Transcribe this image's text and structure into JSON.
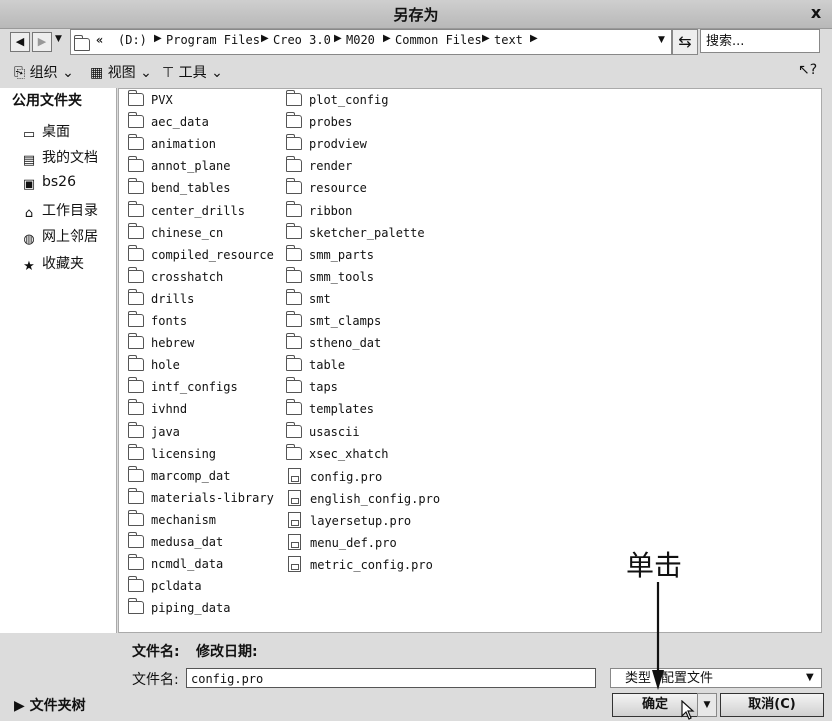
{
  "window": {
    "title": "另存为",
    "close": "x"
  },
  "address": {
    "crumbs": [
      "«",
      "(D:)",
      "Program Files",
      "Creo 3.0",
      "M020",
      "Common Files",
      "text"
    ],
    "search_placeholder": "搜索..."
  },
  "toolbar": {
    "organize": "组织 ⌄",
    "view": "视图 ⌄",
    "tools": "工具 ⌄"
  },
  "sidebar": {
    "header": "公用文件夹",
    "items": [
      "桌面",
      "我的文档",
      "bs26",
      "工作目录",
      "网上邻居",
      "收藏夹"
    ],
    "folder_tree": "文件夹树"
  },
  "files": {
    "col1": [
      "PVX",
      "aec_data",
      "animation",
      "annot_plane",
      "bend_tables",
      "center_drills",
      "chinese_cn",
      "compiled_resource",
      "crosshatch",
      "drills",
      "fonts",
      "hebrew",
      "hole",
      "intf_configs",
      "ivhnd",
      "java",
      "licensing",
      "marcomp_dat",
      "materials-library",
      "mechanism",
      "medusa_dat",
      "ncmdl_data",
      "pcldata",
      "piping_data"
    ],
    "col2_folders": [
      "plot_config",
      "probes",
      "prodview",
      "render",
      "resource",
      "ribbon",
      "sketcher_palette",
      "smm_parts",
      "smm_tools",
      "smt",
      "smt_clamps",
      "stheno_dat",
      "table",
      "taps",
      "templates",
      "usascii",
      "xsec_xhatch"
    ],
    "col2_files": [
      "config.pro",
      "english_config.pro",
      "layersetup.pro",
      "menu_def.pro",
      "metric_config.pro"
    ]
  },
  "info": {
    "filename_label": "文件名:",
    "modified_label": "修改日期:"
  },
  "form": {
    "filename_label": "文件名:",
    "filename_value": "config.pro",
    "type_label": "类型",
    "type_value": "配置文件",
    "ok": "确定",
    "cancel": "取消(C)"
  },
  "annotation": "单击"
}
